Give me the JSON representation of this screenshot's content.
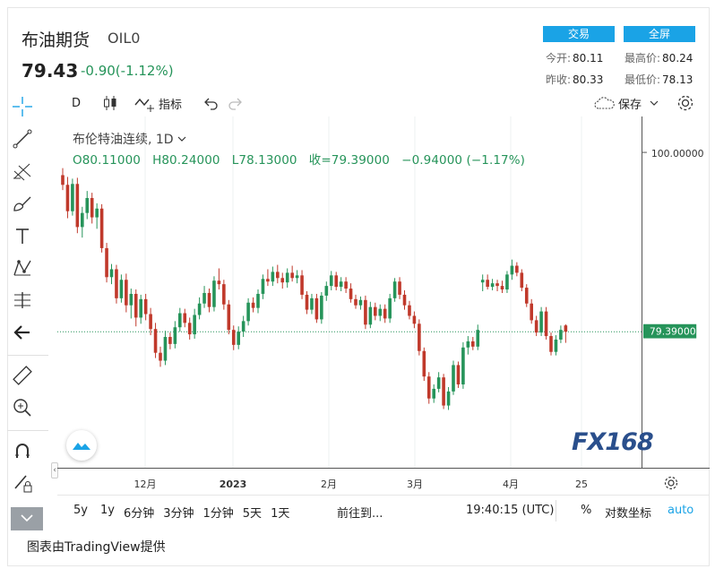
{
  "header": {
    "title": "布油期货",
    "code": "OIL0",
    "price": "79.43",
    "change": "-0.90(-1.12%)",
    "trade_button": "交易",
    "fullscreen_button": "全屏",
    "stats": {
      "open_label": "今开:",
      "open_value": "80.11",
      "high_label": "最高价:",
      "high_value": "80.24",
      "prev_label": "昨收:",
      "prev_value": "80.33",
      "low_label": "最低价:",
      "low_value": "78.13"
    }
  },
  "toolbar": {
    "interval": "D",
    "indicators_label": "指标",
    "save_label": "保存"
  },
  "legend": {
    "symbol_line": "布伦特油连续, 1D",
    "ohlc_line": "O80.11000   H80.24000   L78.13000   收=79.39000   −0.94000 (−1.17%)"
  },
  "price_axis": {
    "top_label": "100.00000",
    "last_label": "79.39000"
  },
  "time_axis": {
    "labels": [
      "12月",
      "2023",
      "2月",
      "3月",
      "4月",
      "25"
    ]
  },
  "bottom_bar": {
    "ranges": [
      "5y",
      "1y",
      "6分钟",
      "3分钟",
      "1分钟",
      "5天",
      "1天"
    ],
    "goto_label": "前往到...",
    "clock": "19:40:15 (UTC)",
    "percent_label": "%",
    "log_label": "对数坐标",
    "auto_label": "auto"
  },
  "watermark": "FX168",
  "credit": "图表由TradingView提供",
  "colors": {
    "up": "#26945a",
    "down": "#c0392b",
    "accent": "#1aa3e6",
    "last_price_badge": "#26945a"
  },
  "chart_data": {
    "type": "candlestick",
    "series": [
      {
        "name": "布伦特油连续",
        "values": [
          [
            97.2,
            98.0,
            95.5,
            96.1
          ],
          [
            96.1,
            97.0,
            92.3,
            93.1
          ],
          [
            93.1,
            96.8,
            92.6,
            96.2
          ],
          [
            96.2,
            96.9,
            90.6,
            91.3
          ],
          [
            91.3,
            93.6,
            90.1,
            92.9
          ],
          [
            92.9,
            95.4,
            92.2,
            94.6
          ],
          [
            94.6,
            95.2,
            91.7,
            92.4
          ],
          [
            92.4,
            94.0,
            91.1,
            93.4
          ],
          [
            93.4,
            93.9,
            88.4,
            88.9
          ],
          [
            88.9,
            89.5,
            85.0,
            85.6
          ],
          [
            85.6,
            87.1,
            84.8,
            86.5
          ],
          [
            86.5,
            87.0,
            82.6,
            83.2
          ],
          [
            83.2,
            85.9,
            82.7,
            85.3
          ],
          [
            85.3,
            86.0,
            81.6,
            82.4
          ],
          [
            82.4,
            84.3,
            80.9,
            83.7
          ],
          [
            83.7,
            84.2,
            80.0,
            81.0
          ],
          [
            81.0,
            83.6,
            80.3,
            83.1
          ],
          [
            83.1,
            83.7,
            80.7,
            81.4
          ],
          [
            81.4,
            82.1,
            79.0,
            79.7
          ],
          [
            79.7,
            80.4,
            76.4,
            77.0
          ],
          [
            77.0,
            77.7,
            75.4,
            76.1
          ],
          [
            76.1,
            79.5,
            75.6,
            78.8
          ],
          [
            78.8,
            79.3,
            77.4,
            78.0
          ],
          [
            78.0,
            80.6,
            77.5,
            79.9
          ],
          [
            79.9,
            82.1,
            79.4,
            81.5
          ],
          [
            81.5,
            82.0,
            79.9,
            80.4
          ],
          [
            80.4,
            81.0,
            78.5,
            79.1
          ],
          [
            79.1,
            82.0,
            78.6,
            81.3
          ],
          [
            81.3,
            83.3,
            80.8,
            82.6
          ],
          [
            82.6,
            84.6,
            82.1,
            83.8
          ],
          [
            83.8,
            84.3,
            81.6,
            82.2
          ],
          [
            82.2,
            85.7,
            81.7,
            85.2
          ],
          [
            85.2,
            86.6,
            84.2,
            84.8
          ],
          [
            84.8,
            85.3,
            81.9,
            82.5
          ],
          [
            82.5,
            83.0,
            79.1,
            79.6
          ],
          [
            79.6,
            80.1,
            77.3,
            77.9
          ],
          [
            77.9,
            80.0,
            77.4,
            79.4
          ],
          [
            79.4,
            81.2,
            78.8,
            80.6
          ],
          [
            80.6,
            83.2,
            80.1,
            82.7
          ],
          [
            82.7,
            83.3,
            81.6,
            82.1
          ],
          [
            82.1,
            84.2,
            81.5,
            83.7
          ],
          [
            83.7,
            85.9,
            83.1,
            85.4
          ],
          [
            85.4,
            86.5,
            84.6,
            85.1
          ],
          [
            85.1,
            86.8,
            84.6,
            86.2
          ],
          [
            86.2,
            87.0,
            84.9,
            85.5
          ],
          [
            85.5,
            86.1,
            84.3,
            85.0
          ],
          [
            85.0,
            86.6,
            84.4,
            86.1
          ],
          [
            86.1,
            86.9,
            85.1,
            85.5
          ],
          [
            85.5,
            86.4,
            84.9,
            85.8
          ],
          [
            85.8,
            86.4,
            83.1,
            83.6
          ],
          [
            83.6,
            84.0,
            81.4,
            81.9
          ],
          [
            81.9,
            83.7,
            81.4,
            83.2
          ],
          [
            83.2,
            83.7,
            80.4,
            80.8
          ],
          [
            80.8,
            83.9,
            80.3,
            83.5
          ],
          [
            83.5,
            85.1,
            82.9,
            84.6
          ],
          [
            84.6,
            86.3,
            84.1,
            85.8
          ],
          [
            85.8,
            86.2,
            84.1,
            84.5
          ],
          [
            84.5,
            85.6,
            84.0,
            85.1
          ],
          [
            85.1,
            85.6,
            83.8,
            84.3
          ],
          [
            84.3,
            84.9,
            82.7,
            83.1
          ],
          [
            83.1,
            83.6,
            82.0,
            82.4
          ],
          [
            82.4,
            83.4,
            81.9,
            83.0
          ],
          [
            83.0,
            83.5,
            79.7,
            80.2
          ],
          [
            80.2,
            82.8,
            79.8,
            82.2
          ],
          [
            82.2,
            82.7,
            80.7,
            81.2
          ],
          [
            81.2,
            82.5,
            80.6,
            82.0
          ],
          [
            82.0,
            82.5,
            80.4,
            80.9
          ],
          [
            80.9,
            83.7,
            80.4,
            83.2
          ],
          [
            83.2,
            85.5,
            82.8,
            85.1
          ],
          [
            85.1,
            85.6,
            83.1,
            83.6
          ],
          [
            83.6,
            84.1,
            81.9,
            82.4
          ],
          [
            82.4,
            82.9,
            80.8,
            81.2
          ],
          [
            81.2,
            81.7,
            79.8,
            80.3
          ],
          [
            80.3,
            80.8,
            76.7,
            77.2
          ],
          [
            77.2,
            77.6,
            73.8,
            74.3
          ],
          [
            74.3,
            74.8,
            71.2,
            71.8
          ],
          [
            71.8,
            73.4,
            71.3,
            72.9
          ],
          [
            72.9,
            74.8,
            72.5,
            74.2
          ],
          [
            74.2,
            74.6,
            70.6,
            71.0
          ],
          [
            71.0,
            73.1,
            70.5,
            72.6
          ],
          [
            72.6,
            76.1,
            72.2,
            75.6
          ],
          [
            75.6,
            76.0,
            73.0,
            73.4
          ],
          [
            73.4,
            78.2,
            72.9,
            77.6
          ],
          [
            77.6,
            78.9,
            76.8,
            78.3
          ],
          [
            78.3,
            78.8,
            77.3,
            77.7
          ],
          [
            77.7,
            80.2,
            77.3,
            79.6
          ],
          [
            85.0,
            85.9,
            84.0,
            85.3
          ],
          [
            85.3,
            85.9,
            84.2,
            84.5
          ],
          [
            84.5,
            85.4,
            84.1,
            84.9
          ],
          [
            84.9,
            85.3,
            84.0,
            84.6
          ],
          [
            84.6,
            85.2,
            83.8,
            84.2
          ],
          [
            84.2,
            86.3,
            83.8,
            85.9
          ],
          [
            85.9,
            87.6,
            85.3,
            86.9
          ],
          [
            86.9,
            87.3,
            85.7,
            86.1
          ],
          [
            86.1,
            86.5,
            84.0,
            84.4
          ],
          [
            84.4,
            84.8,
            82.2,
            82.6
          ],
          [
            82.6,
            83.1,
            80.3,
            80.7
          ],
          [
            80.7,
            81.2,
            78.9,
            79.3
          ],
          [
            79.3,
            82.2,
            78.9,
            81.7
          ],
          [
            81.7,
            82.2,
            78.5,
            78.9
          ],
          [
            78.9,
            79.3,
            76.7,
            77.1
          ],
          [
            77.1,
            79.0,
            76.7,
            78.5
          ],
          [
            78.5,
            80.1,
            78.1,
            79.6
          ],
          [
            80.11,
            80.24,
            78.13,
            79.39
          ]
        ]
      }
    ],
    "x_ticks": [
      "12月",
      "2023",
      "2月",
      "3月",
      "4月",
      "25"
    ],
    "ylim": [
      68,
      100
    ],
    "last_price": 79.39,
    "grid": true
  }
}
